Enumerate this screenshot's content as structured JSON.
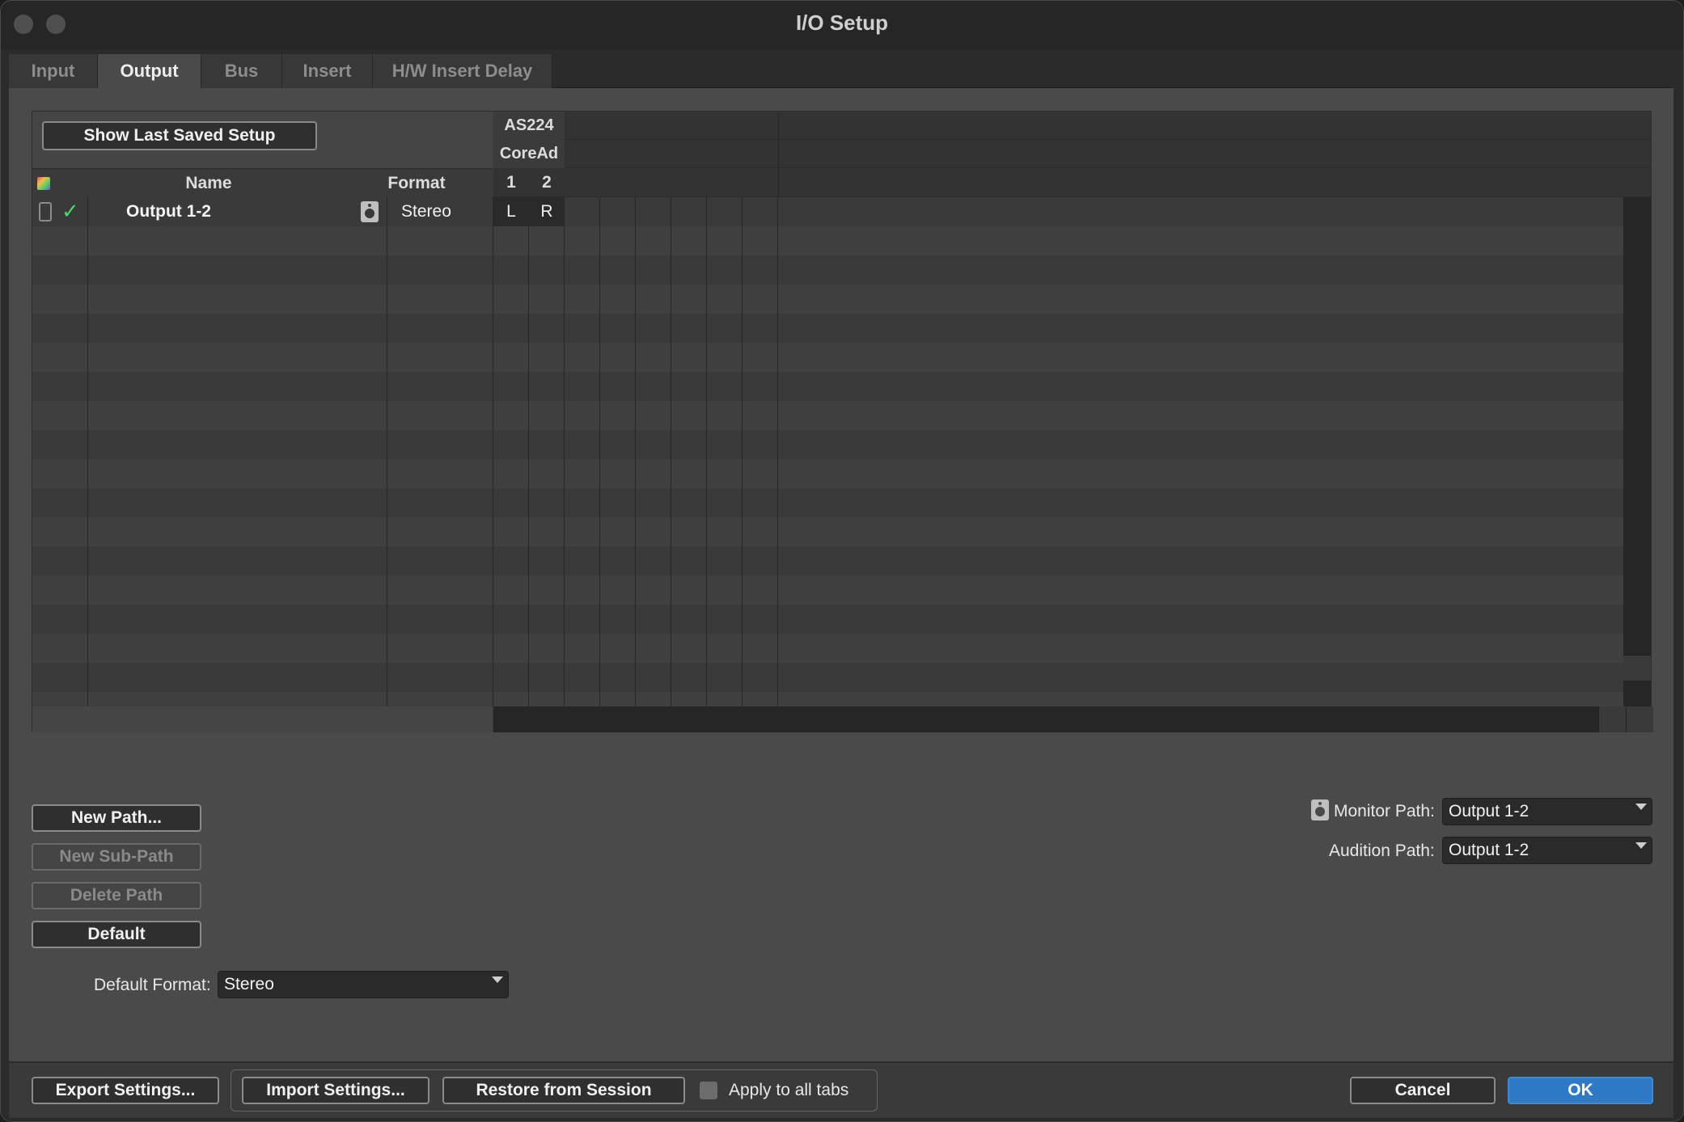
{
  "window": {
    "title": "I/O Setup"
  },
  "tabs": [
    {
      "label": "Input",
      "active": false
    },
    {
      "label": "Output",
      "active": true
    },
    {
      "label": "Bus",
      "active": false
    },
    {
      "label": "Insert",
      "active": false
    },
    {
      "label": "H/W Insert Delay",
      "active": false
    }
  ],
  "grid": {
    "show_last_saved_label": "Show Last Saved Setup",
    "device_label": "AS224",
    "driver_label": "CoreAd",
    "columns": {
      "name": "Name",
      "format": "Format",
      "channel_1": "1",
      "channel_2": "2"
    },
    "rows": [
      {
        "enabled": true,
        "name": "Output 1-2",
        "format": "Stereo",
        "ch1": "L",
        "ch2": "R"
      }
    ]
  },
  "path_buttons": {
    "new_path": "New Path...",
    "new_sub_path": "New Sub-Path",
    "delete_path": "Delete Path",
    "default": "Default"
  },
  "default_format": {
    "label": "Default Format:",
    "value": "Stereo"
  },
  "monitor_path": {
    "label": "Monitor Path:",
    "value": "Output 1-2"
  },
  "audition_path": {
    "label": "Audition Path:",
    "value": "Output 1-2"
  },
  "bottom": {
    "export_label": "Export Settings...",
    "import_label": "Import Settings...",
    "restore_label": "Restore from Session",
    "apply_all_label": "Apply to all tabs",
    "cancel_label": "Cancel",
    "ok_label": "OK"
  },
  "colors": {
    "accent": "#2f7ac6",
    "check": "#4dd46a"
  }
}
